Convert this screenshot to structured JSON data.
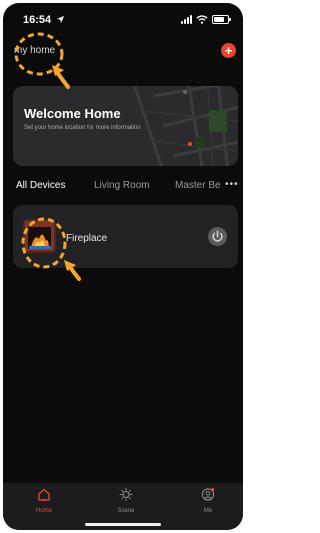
{
  "status_bar": {
    "time": "16:54"
  },
  "header": {
    "home_name": "my home",
    "add_label": "+"
  },
  "welcome": {
    "title": "Welcome Home",
    "subtitle": "Set your home location for more information"
  },
  "room_tabs": [
    {
      "label": "All Devices",
      "selected": true
    },
    {
      "label": "Living Room",
      "selected": false
    },
    {
      "label": "Master Be",
      "selected": false
    }
  ],
  "more_label": "•••",
  "devices": [
    {
      "name": "Fireplace",
      "power": "off"
    }
  ],
  "tab_bar": {
    "items": [
      {
        "label": "Home",
        "icon": "home-icon",
        "active": true
      },
      {
        "label": "Scene",
        "icon": "sun-icon",
        "active": false
      },
      {
        "label": "Me",
        "icon": "person-icon",
        "active": false,
        "badge": true
      }
    ]
  },
  "colors": {
    "accent": "#e8452c",
    "background": "#0b0b0c",
    "card": "#2b2b2d",
    "annotation": "#f4a72b"
  }
}
